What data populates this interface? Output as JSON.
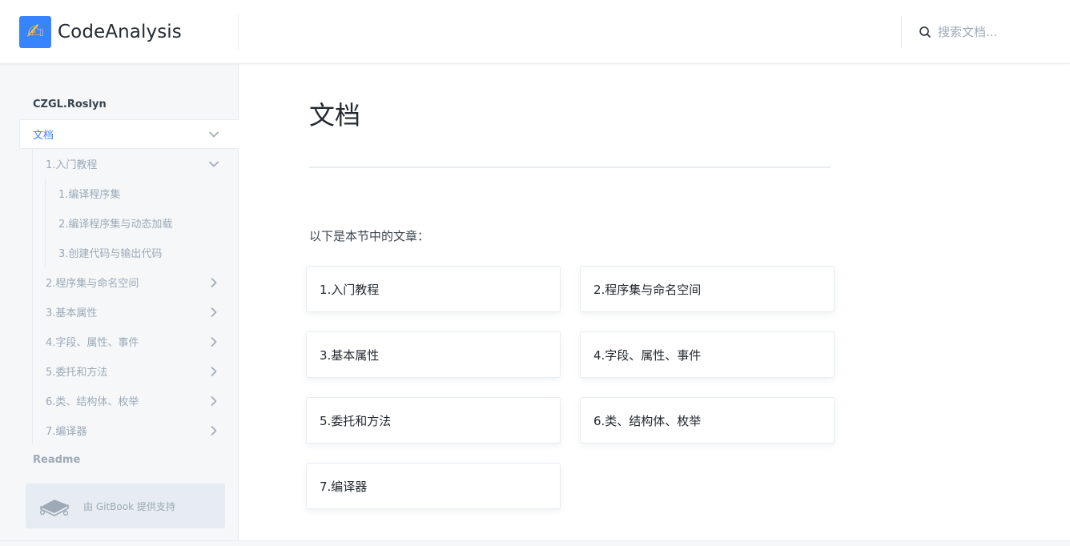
{
  "header": {
    "logo_glyph": "✍",
    "title": "CodeAnalysis",
    "search": {
      "placeholder": "搜索文档..."
    }
  },
  "sidebar": {
    "root": "CZGL.Roslyn",
    "active": "文档",
    "groups": [
      {
        "label": "1.入门教程",
        "expanded": true,
        "children": [
          "1.编译程序集",
          "2.编译程序集与动态加载",
          "3.创建代码与输出代码"
        ]
      },
      {
        "label": "2.程序集与命名空间",
        "expanded": false
      },
      {
        "label": "3.基本属性",
        "expanded": false
      },
      {
        "label": "4.字段、属性、事件",
        "expanded": false
      },
      {
        "label": "5.委托和方法",
        "expanded": false
      },
      {
        "label": "6.类、结构体、枚举",
        "expanded": false
      },
      {
        "label": "7.编译器",
        "expanded": false
      }
    ],
    "readme": "Readme",
    "powered_by": "由 GitBook 提供支持"
  },
  "main": {
    "title": "文档",
    "intro": "以下是本节中的文章：",
    "cards": [
      "1.入门教程",
      "2.程序集与命名空间",
      "3.基本属性",
      "4.字段、属性、事件",
      "5.委托和方法",
      "6.类、结构体、枚举",
      "7.编译器"
    ]
  },
  "colors": {
    "accent": "#3884ff",
    "sidebar_bg": "#f5f7f9",
    "border": "#e6ecf1",
    "muted_text": "#9daab6",
    "text": "#242a31"
  }
}
